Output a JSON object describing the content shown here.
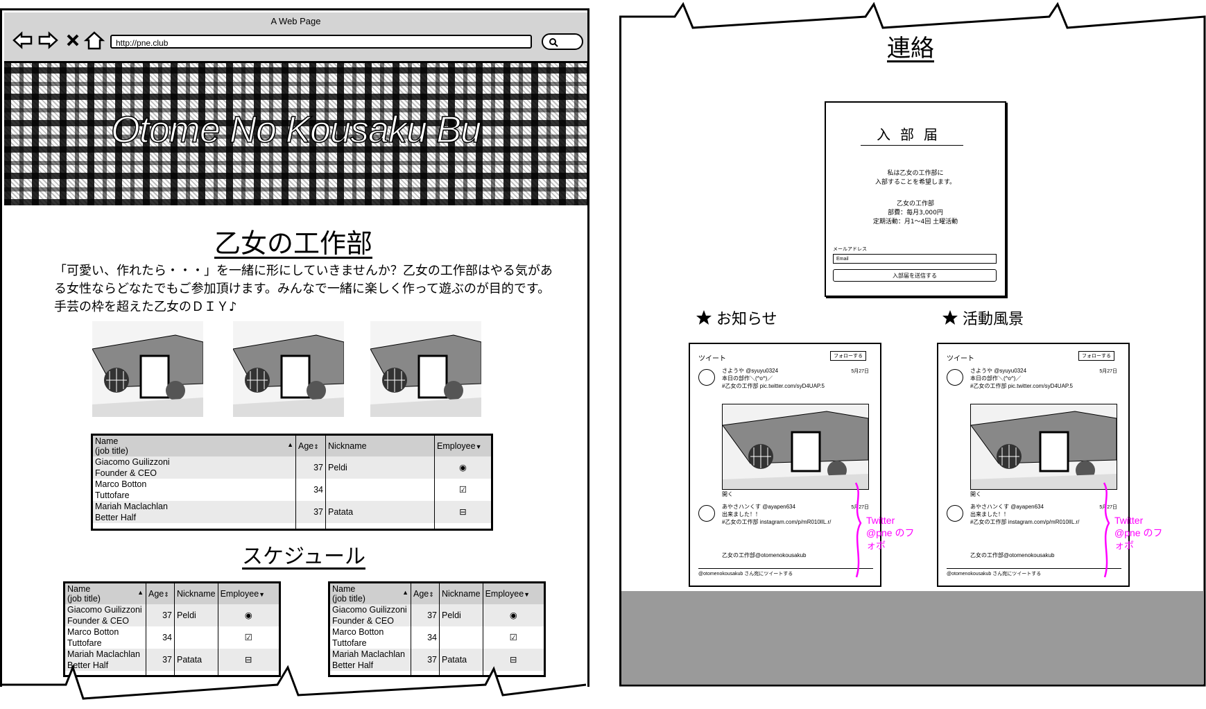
{
  "browser": {
    "window_title": "A Web Page",
    "url": "http://pne.club",
    "banner_title": "Otome No Kousaku Bu"
  },
  "club": {
    "heading": "乙女の工作部",
    "description": "「可愛い、作れたら・・・」を一緒に形にしていきませんか？乙女の工作部はやる気がある女性ならどなたでもご参加頂けます。みんなで一緒に楽しく作って遊ぶのが目的です。手芸の枠を超えた乙女のＤＩＹ♪"
  },
  "schedule": {
    "heading": "スケジュール"
  },
  "table": {
    "headers": {
      "name": "Name",
      "job_title": "(job title)",
      "age": "Age",
      "nickname": "Nickname",
      "employee": "Employee"
    },
    "rows": [
      {
        "name": "Giacomo Guilizzoni",
        "title": "Founder & CEO",
        "age": "37",
        "nickname": "Peldi",
        "employee": "◉"
      },
      {
        "name": "Marco Botton",
        "title": "Tuttofare",
        "age": "34",
        "nickname": "",
        "employee": "☑"
      },
      {
        "name": "Mariah Maclachlan",
        "title": "Better Half",
        "age": "37",
        "nickname": "Patata",
        "employee": "⊟"
      }
    ]
  },
  "contact": {
    "heading": "連絡",
    "form_title": "入部届",
    "form_line1": "私は乙女の工作部に",
    "form_line2": "入部することを希望します。",
    "form_line3": "乙女の工作部",
    "form_line4": "部費：毎月3,000円",
    "form_line5": "定期活動：月1〜4回 土曜活動",
    "email_label": "メールアドレス",
    "email_value": "Email",
    "submit_label": "入部届を送信する"
  },
  "sections": {
    "news": "お知らせ",
    "activity": "活動風景"
  },
  "twitter_widget": {
    "header": "ツイート",
    "follow": "フォローする",
    "tweet1_user": "さようや @syuyu0324",
    "tweet1_line1": "本日の部作＼(^o^)／",
    "tweet1_line2": "#乙女の工作部 pic.twitter.com/syD4UAP.5",
    "tweet1_time": "5月27日",
    "tweet2_user": "あやさハンくす @ayapen634",
    "tweet2_line1": "出来ました！！",
    "tweet2_line2": "#乙女の工作部 instagram.com/p/mR010lIL.r/",
    "tweet2_time": "5月27日",
    "expand": "開く",
    "footer_user": "乙女の工作部@otomenokousakub",
    "footer": "@otomenokousakub さん宛にツイートする",
    "annotation": "Twitter @pne のフォボ"
  },
  "colors": {
    "annotation": "#ff00ff",
    "footer_gray": "#9a9a9a",
    "chrome_gray": "#d4d4d4",
    "header_gray": "#cfcfcf"
  }
}
